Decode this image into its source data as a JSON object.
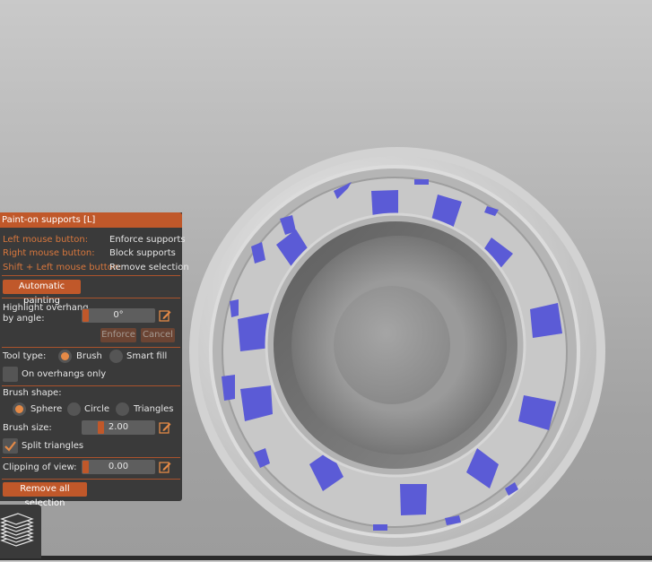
{
  "panel": {
    "title": "Paint-on supports [L]",
    "mouse_help": [
      {
        "key": "Left mouse button:",
        "action": "Enforce supports"
      },
      {
        "key": "Right mouse button:",
        "action": "Block supports"
      },
      {
        "key": "Shift + Left mouse button:",
        "action": "Remove selection"
      }
    ],
    "automatic_painting_label": "Automatic painting",
    "highlight_label_line1": "Highlight overhang",
    "highlight_label_line2": "by angle:",
    "highlight_value": "0°",
    "enforce_label": "Enforce",
    "cancel_label": "Cancel",
    "tool_type_label": "Tool type:",
    "tool_brush": "Brush",
    "tool_smart_fill": "Smart fill",
    "tool_selected": "Brush",
    "on_overhangs_only_label": "On overhangs only",
    "on_overhangs_only_checked": false,
    "brush_shape_label": "Brush shape:",
    "shape_sphere": "Sphere",
    "shape_circle": "Circle",
    "shape_triangles": "Triangles",
    "shape_selected": "Sphere",
    "brush_size_label": "Brush size:",
    "brush_size_value": "2.00",
    "split_triangles_label": "Split triangles",
    "split_triangles_checked": true,
    "clipping_label": "Clipping of view:",
    "clipping_value": "0.00",
    "remove_all_label": "Remove all selection"
  },
  "colors": {
    "accent": "#c0582a",
    "radio_on": "#e58a47",
    "support_paint": "#5b5bd6",
    "panel_bg": "#3a3a3a"
  },
  "icons": {
    "edit": "pencil-edit-icon",
    "layers": "layers-icon"
  }
}
